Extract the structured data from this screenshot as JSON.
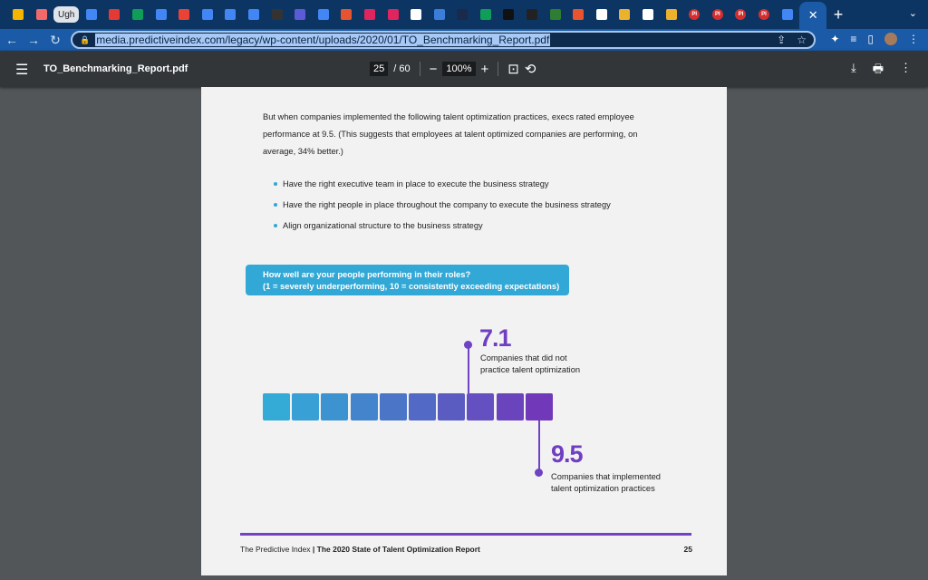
{
  "browser": {
    "tabs": [
      {
        "icon": "google-drive-icon",
        "color": "#f4b400"
      },
      {
        "icon": "asana-icon",
        "color": "#f06a6a"
      },
      {
        "label": "Ugh"
      },
      {
        "icon": "google-docs-icon",
        "color": "#4285f4"
      },
      {
        "icon": "red-circle-icon",
        "color": "#e53935"
      },
      {
        "icon": "google-drive-icon",
        "color": "#0f9d58"
      },
      {
        "icon": "google-docs-icon",
        "color": "#4285f4"
      },
      {
        "icon": "gmail-icon",
        "color": "#ea4335"
      },
      {
        "icon": "google-docs-icon",
        "color": "#4285f4"
      },
      {
        "icon": "google-docs-icon",
        "color": "#4285f4"
      },
      {
        "icon": "google-docs-icon",
        "color": "#4285f4"
      },
      {
        "icon": "g-icon",
        "color": "#333333"
      },
      {
        "icon": "gear-icon",
        "color": "#5b5bd6"
      },
      {
        "icon": "google-docs-icon",
        "color": "#4285f4"
      },
      {
        "icon": "arc-icon",
        "color": "#e8542f"
      },
      {
        "icon": "dots-icon",
        "color": "#e0245e"
      },
      {
        "icon": "dots-icon",
        "color": "#e0245e"
      },
      {
        "icon": "google-icon",
        "color": "#ffffff"
      },
      {
        "icon": "image-icon",
        "color": "#3b7dd8"
      },
      {
        "icon": "x-logo-icon",
        "color": "#1b2a4a"
      },
      {
        "icon": "google-drive-icon",
        "color": "#0f9d58"
      },
      {
        "icon": "rl-icon",
        "color": "#111111"
      },
      {
        "icon": "diamond-icon",
        "color": "#222222"
      },
      {
        "icon": "circle-logo-icon",
        "color": "#2e7d32"
      },
      {
        "icon": "t-icon",
        "color": "#e8542f"
      },
      {
        "icon": "google-icon",
        "color": "#ffffff"
      },
      {
        "icon": "slack-icon",
        "color": "#ecb22e"
      },
      {
        "icon": "globe-icon",
        "color": "#ffffff"
      },
      {
        "icon": "slack-icon",
        "color": "#ecb22e"
      },
      {
        "icon": "pi-icon",
        "color": "#d32f2f",
        "label": "PI"
      },
      {
        "icon": "pi-icon",
        "color": "#d32f2f",
        "label": "PI"
      },
      {
        "icon": "pi-icon",
        "color": "#d32f2f",
        "label": "PI"
      },
      {
        "icon": "pi-icon",
        "color": "#d32f2f",
        "label": "PI"
      },
      {
        "icon": "google-docs-icon",
        "color": "#4285f4"
      }
    ],
    "url": "media.predictiveindex.com/legacy/wp-content/uploads/2020/01/TO_Benchmarking_Report.pdf"
  },
  "pdf": {
    "filename": "TO_Benchmarking_Report.pdf",
    "current_page": "25",
    "total_pages": "/ 60",
    "zoom": "100%"
  },
  "content": {
    "paragraph": "But when companies implemented the following talent optimization practices, execs rated employee performance at 9.5. (This suggests that employees at talent optimized companies are performing, on average, 34% better.)",
    "bullets": [
      "Have the right executive team in place to execute the business strategy",
      "Have the right people in place throughout the company to execute the business strategy",
      "Align organizational structure to the business strategy"
    ],
    "question_line1": "How well are your people performing in their roles?",
    "question_line2": "(1 = severely underperforming, 10 = consistently exceeding expectations)",
    "scale_colors": [
      "#34aad6",
      "#38a0d4",
      "#3d93d0",
      "#4484cd",
      "#4b76c8",
      "#5369c6",
      "#5b5cc2",
      "#6450c0",
      "#6a44bc",
      "#7238ba"
    ],
    "value_no": "7.1",
    "label_no_1": "Companies that did not",
    "label_no_2": "practice talent optimization",
    "value_yes": "9.5",
    "label_yes_1": "Companies that implemented",
    "label_yes_2": "talent optimization practices",
    "footer_brand": "The Predictive Index",
    "footer_sep": "|",
    "footer_title": "The 2020 State of Talent Optimization Report",
    "page_number": "25"
  }
}
